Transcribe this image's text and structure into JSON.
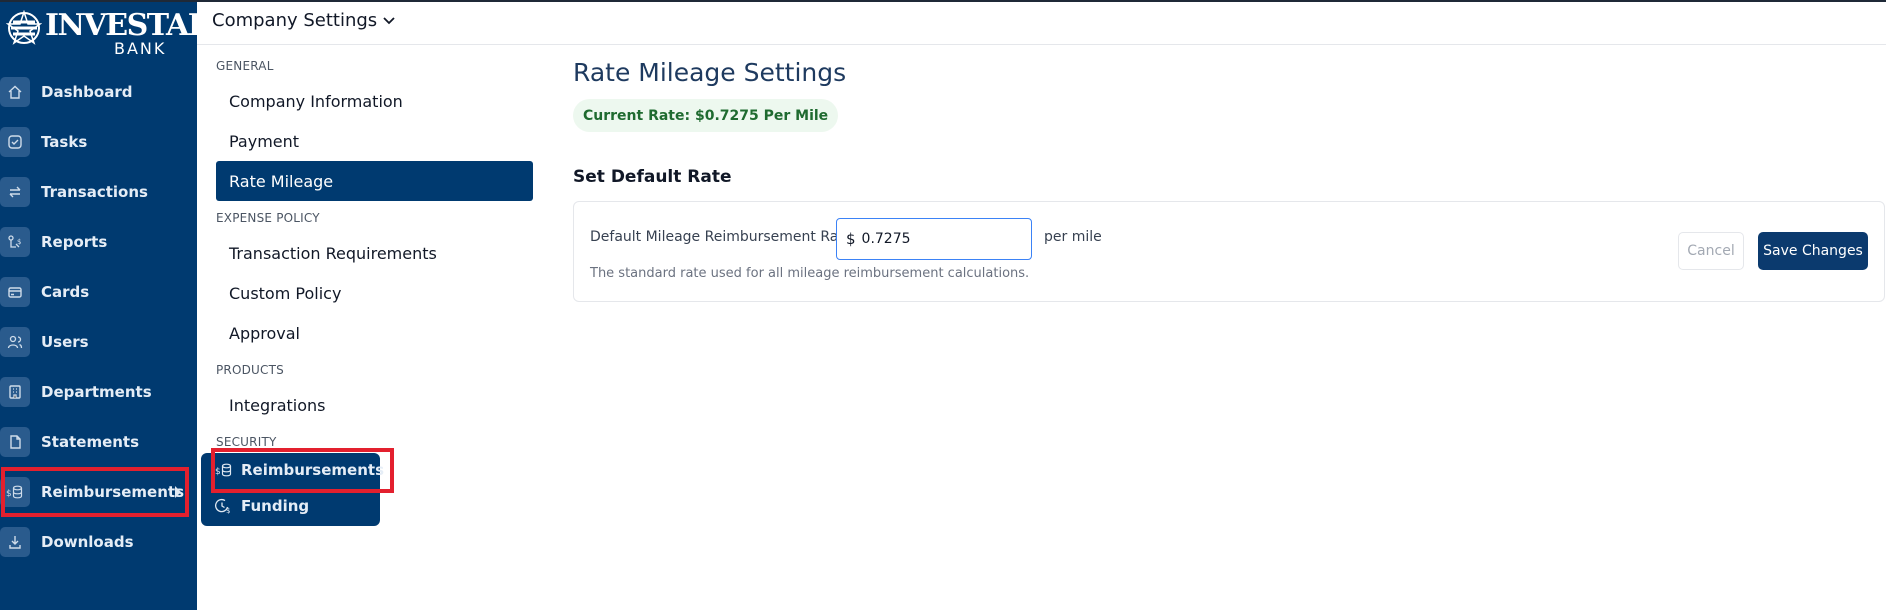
{
  "brand": {
    "name": "INVESTAR",
    "sub": "BANK"
  },
  "sidebar": {
    "items": [
      {
        "label": "Dashboard",
        "icon": "home-icon"
      },
      {
        "label": "Tasks",
        "icon": "check-circle-icon"
      },
      {
        "label": "Transactions",
        "icon": "swap-arrows-icon"
      },
      {
        "label": "Reports",
        "icon": "report-icon"
      },
      {
        "label": "Cards",
        "icon": "credit-card-icon"
      },
      {
        "label": "Users",
        "icon": "users-icon"
      },
      {
        "label": "Departments",
        "icon": "building-icon"
      },
      {
        "label": "Statements",
        "icon": "document-icon"
      },
      {
        "label": "Reimbursements",
        "icon": "coins-icon",
        "active": true
      },
      {
        "label": "Downloads",
        "icon": "download-icon"
      }
    ]
  },
  "header": {
    "title": "Company Settings"
  },
  "settings_nav": {
    "sections": [
      {
        "label": "GENERAL",
        "items": [
          "Company Information",
          "Payment",
          "Rate Mileage"
        ]
      },
      {
        "label": "EXPENSE POLICY",
        "items": [
          "Transaction Requirements",
          "Custom Policy",
          "Approval"
        ]
      },
      {
        "label": "PRODUCTS",
        "items": [
          "Integrations"
        ]
      },
      {
        "label": "SECURITY",
        "items": []
      }
    ],
    "active_item": "Rate Mileage"
  },
  "popup_menu": {
    "items": [
      {
        "label": "Reimbursements",
        "icon": "coins-icon"
      },
      {
        "label": "Funding",
        "icon": "clock-dollar-icon"
      }
    ]
  },
  "main": {
    "title": "Rate Mileage Settings",
    "current_rate": "Current Rate: $0.7275 Per Mile",
    "section_title": "Set Default Rate",
    "field_label": "Default Mileage Reimbursement Rate:",
    "currency_symbol": "$",
    "rate_value": "0.7275",
    "unit": "per mile",
    "help_text": "The standard rate used for all mileage reimbursement calculations.",
    "cancel_label": "Cancel",
    "save_label": "Save Changes"
  },
  "colors": {
    "sidebar_bg": "#003a70",
    "highlight": "#e3202e",
    "rate_text": "#1f6b30",
    "save_bg": "#0b3a6e"
  }
}
